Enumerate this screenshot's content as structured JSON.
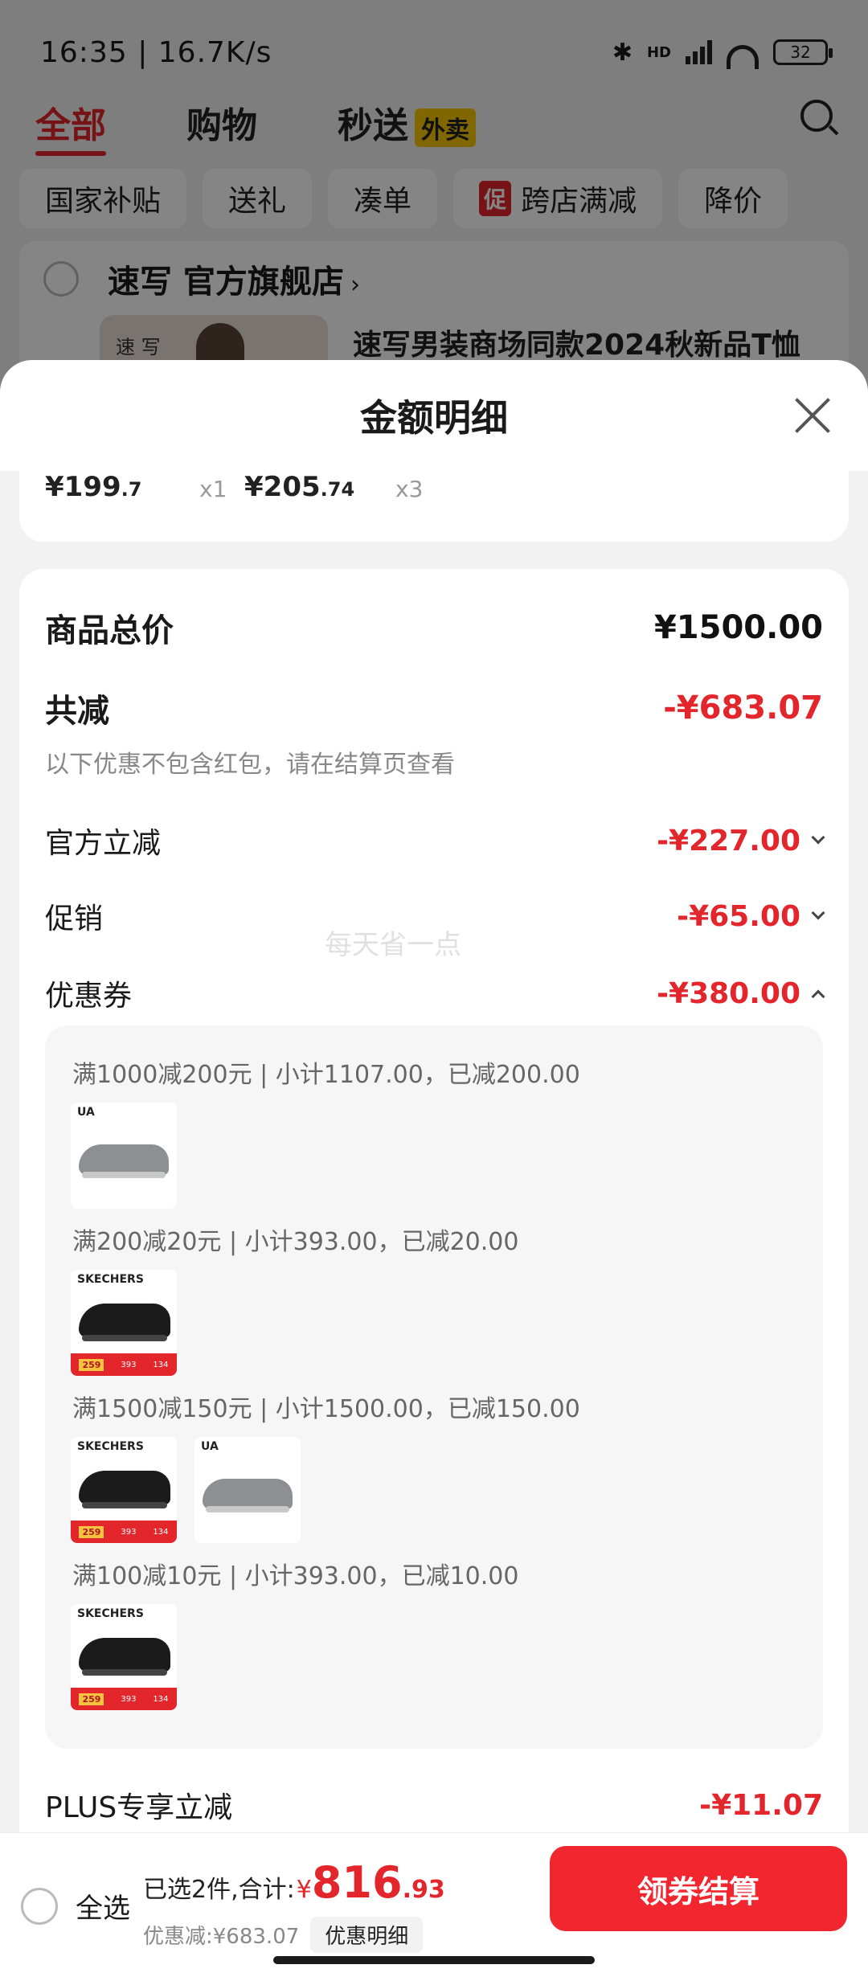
{
  "status_bar": {
    "time": "16:35 | 16.7K/s",
    "battery": "32",
    "network": "HD"
  },
  "top_tabs": [
    {
      "label": "全部"
    },
    {
      "label": "购物"
    },
    {
      "label": "秒送"
    }
  ],
  "waimai_badge": "外卖",
  "filters": [
    {
      "label": "国家补贴"
    },
    {
      "label": "送礼"
    },
    {
      "label": "凑单"
    },
    {
      "label": "跨店满减",
      "badge": "促"
    },
    {
      "label": "降价"
    }
  ],
  "store": {
    "name": "速写 官方旗舰店",
    "chevron": "›",
    "thumb_text": "速\n写",
    "product_title": "速写男装商场同款2024秋新品T恤"
  },
  "sheet": {
    "title": "金额明细",
    "mini_prices": [
      {
        "price_main": "¥199",
        "price_dec": ".7",
        "qty": "x1"
      },
      {
        "price_main": "¥205",
        "price_dec": ".74",
        "qty": "x3"
      }
    ],
    "goods_total_label": "商品总价",
    "goods_total_value": "¥1500.00",
    "reduce_label": "共减",
    "reduce_value": "-¥683.07",
    "reduce_note": "以下优惠不包含红包，请在结算页查看",
    "watermark": "每天省一点",
    "items": [
      {
        "label": "官方立减",
        "value": "-¥227.00",
        "expanded": false
      },
      {
        "label": "促销",
        "value": "-¥65.00",
        "expanded": false
      },
      {
        "label": "优惠券",
        "value": "-¥380.00",
        "expanded": true
      }
    ],
    "coupons": [
      {
        "text": "满1000减200元 | 小计1107.00，已减200.00",
        "shoes": [
          "grey"
        ]
      },
      {
        "text": "满200减20元 | 小计393.00，已减20.00",
        "shoes": [
          "black"
        ]
      },
      {
        "text": "满1500减150元 | 小计1500.00，已减150.00",
        "shoes": [
          "black",
          "grey"
        ]
      },
      {
        "text": "满100减10元 | 小计393.00，已减10.00",
        "shoes": [
          "black"
        ]
      }
    ],
    "plus_label": "PLUS专享立减",
    "plus_value": "-¥11.07"
  },
  "shoe_marks": {
    "grey_brand": "UA",
    "black_brand": "SKECHERS",
    "promo_price": "259",
    "promo_mid": "393",
    "promo_right": "134"
  },
  "bottom_bar": {
    "select_all": "全选",
    "selected_text": "已选2件,合计:",
    "currency": "¥",
    "total_int": "816",
    "total_dec": ".93",
    "discount_text": "优惠减:¥683.07",
    "detail_button": "优惠明细",
    "checkout_button": "领券结算"
  },
  "colors": {
    "accent": "#e3252c",
    "checkout": "#f1262e",
    "waimai": "#f7c600"
  }
}
